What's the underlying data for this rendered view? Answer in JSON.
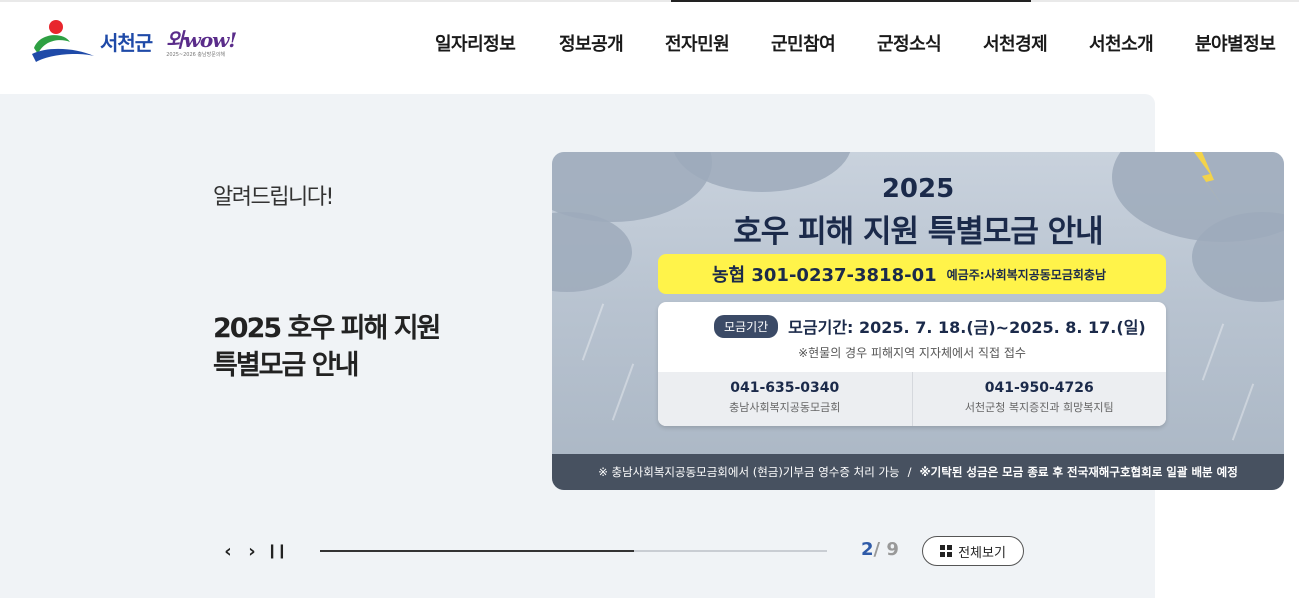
{
  "header": {
    "logo_text": "서천군",
    "slogan_main": "와wow!",
    "slogan_sub": "2025~2026 충남방문의해",
    "nav": [
      "일자리정보",
      "정보공개",
      "전자민원",
      "군민참여",
      "군정소식",
      "서천경제",
      "서천소개",
      "분야별정보"
    ]
  },
  "main": {
    "notice_label": "알려드립니다!",
    "headline_line1": "2025 호우 피해 지원",
    "headline_line2": "특별모금 안내"
  },
  "banner": {
    "year": "2025",
    "title": "호우 피해 지원 특별모금 안내",
    "bank_account": "농협 301-0237-3818-01",
    "account_holder": "예금주:사회복지공동모금회충남",
    "period_badge": "모금기간",
    "period_text": "모금기간: 2025. 7. 18.(금)~2025. 8. 17.(일)",
    "note": "※현물의 경우 피해지역 지자체에서 직접 접수",
    "contacts": [
      {
        "phone": "041-635-0340",
        "org": "충남사회복지공동모금회"
      },
      {
        "phone": "041-950-4726",
        "org": "서천군청 복지증진과 희망복지팀"
      }
    ],
    "footer_left": "※ 충남사회복지공동모금회에서 (현금)기부금 영수증 처리 가능",
    "footer_sep": "/",
    "footer_right": "※기탁된 성금은 모금 종료 후 전국재해구호협회로 일괄 배분 예정"
  },
  "slider": {
    "prev_icon": "‹",
    "next_icon": "›",
    "pause_icon": "❙❙",
    "current": "2",
    "slash": "/",
    "total": "9",
    "progress_fraction": 0.62,
    "view_all_label": "전체보기"
  },
  "colors": {
    "accent_blue": "#2e5aa8",
    "panel_bg": "#f0f3f6",
    "highlight_yellow": "#fff34a"
  }
}
